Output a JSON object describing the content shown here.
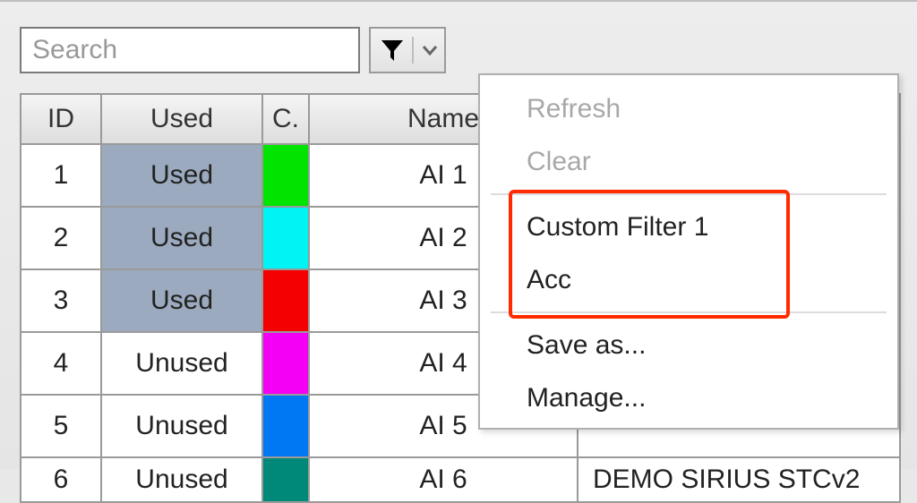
{
  "search": {
    "placeholder": "Search"
  },
  "columns": {
    "id": "ID",
    "used": "Used",
    "c": "C.",
    "name": "Name"
  },
  "rows": [
    {
      "id": "1",
      "used": "Used",
      "usedState": true,
      "color": "#00e400",
      "name": "AI 1"
    },
    {
      "id": "2",
      "used": "Used",
      "usedState": true,
      "color": "#00f4f4",
      "name": "AI 2"
    },
    {
      "id": "3",
      "used": "Used",
      "usedState": true,
      "color": "#f40000",
      "name": "AI 3"
    },
    {
      "id": "4",
      "used": "Unused",
      "usedState": false,
      "color": "#f400f4",
      "name": "AI 4"
    },
    {
      "id": "5",
      "used": "Unused",
      "usedState": false,
      "color": "#0078f4",
      "name": "AI 5"
    },
    {
      "id": "6",
      "used": "Unused",
      "usedState": false,
      "color": "#008878",
      "name": "AI 6"
    }
  ],
  "hiddenRowText": "DEMO SIRIUS STCv2",
  "menu": {
    "refresh": "Refresh",
    "clear": "Clear",
    "custom1": "Custom Filter 1",
    "acc": "Acc",
    "saveas": "Save as...",
    "manage": "Manage..."
  }
}
